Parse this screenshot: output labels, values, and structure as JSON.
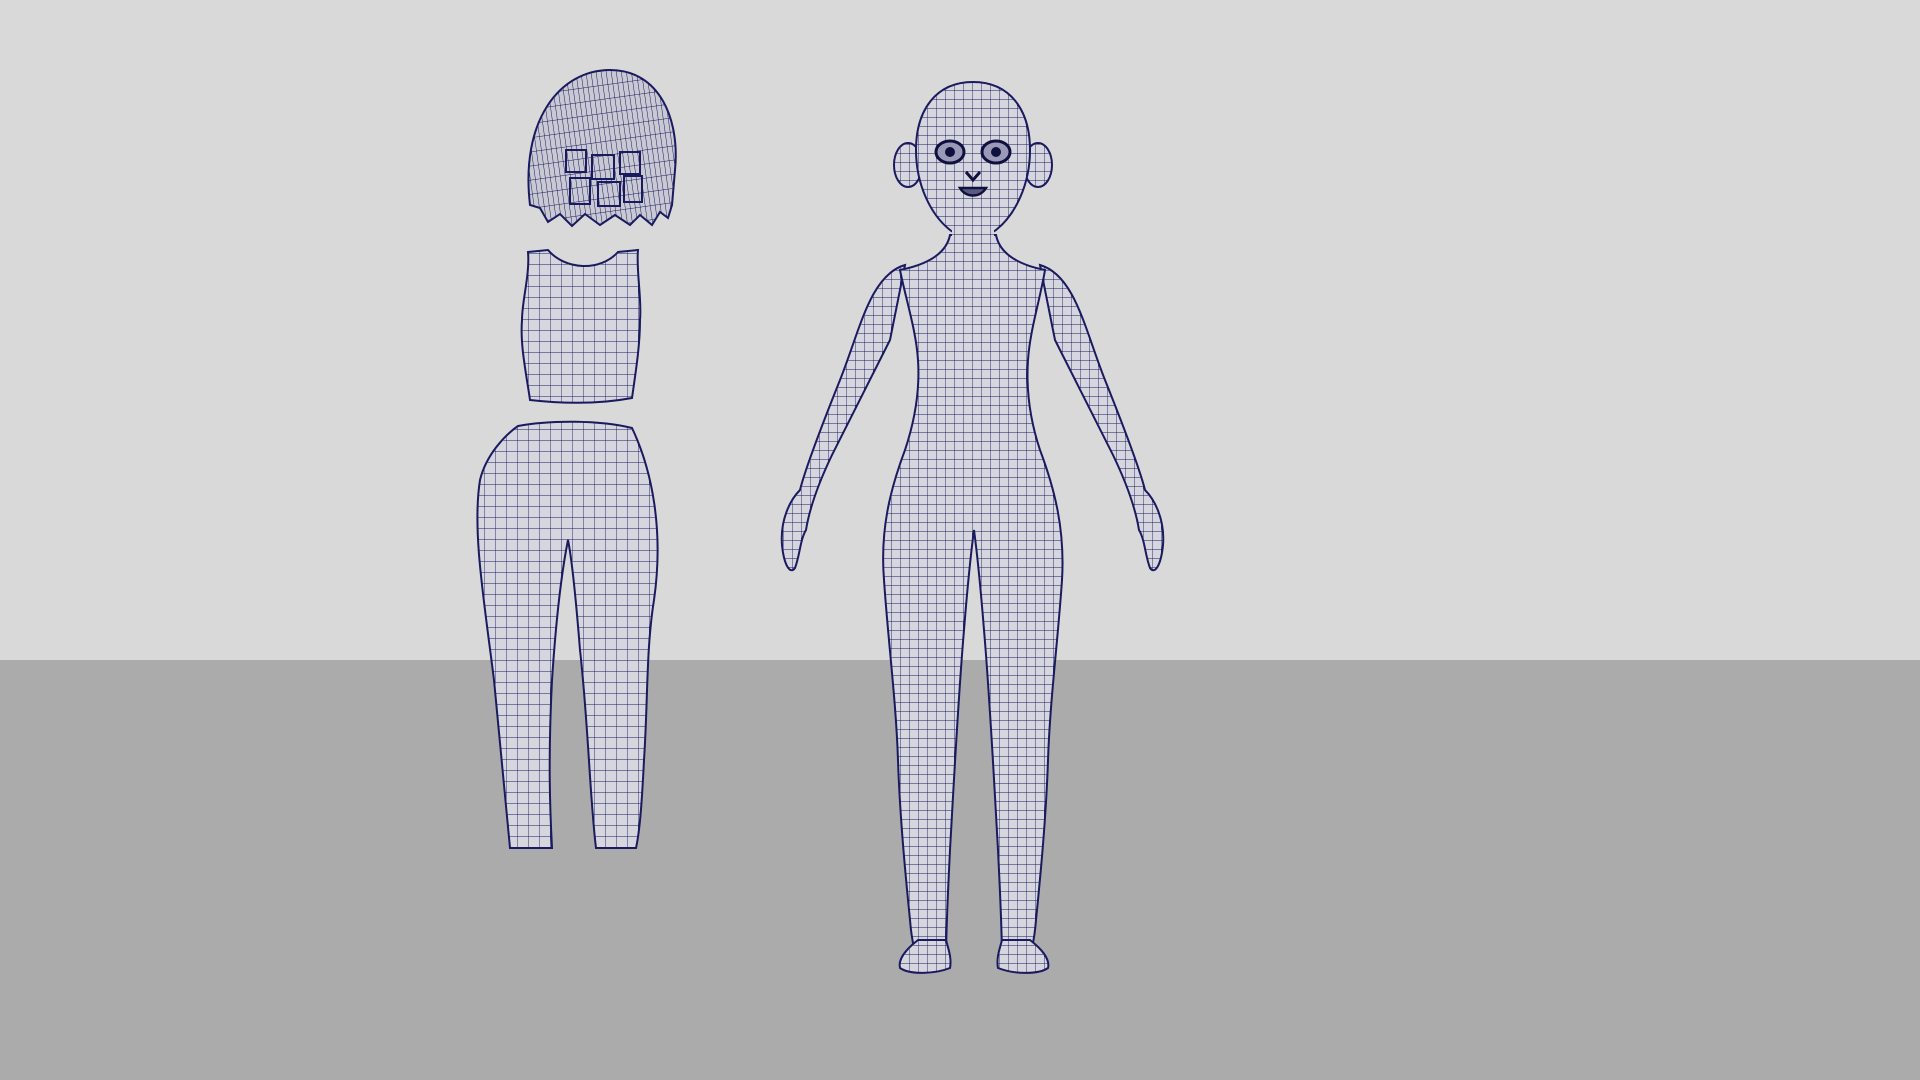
{
  "scene": {
    "colors": {
      "backdrop": "#d9d9d9",
      "floor": "#ababab",
      "mesh_fill": "#d6d6de",
      "wire": "#1a1a5e",
      "hair_fill": "#c9c9d4",
      "face_feature": "#10103f"
    },
    "pieces": [
      "hair-mesh",
      "crop-top-mesh",
      "leggings-mesh",
      "character-body-mesh"
    ],
    "display_mode": "wireframe-on-shaded"
  }
}
